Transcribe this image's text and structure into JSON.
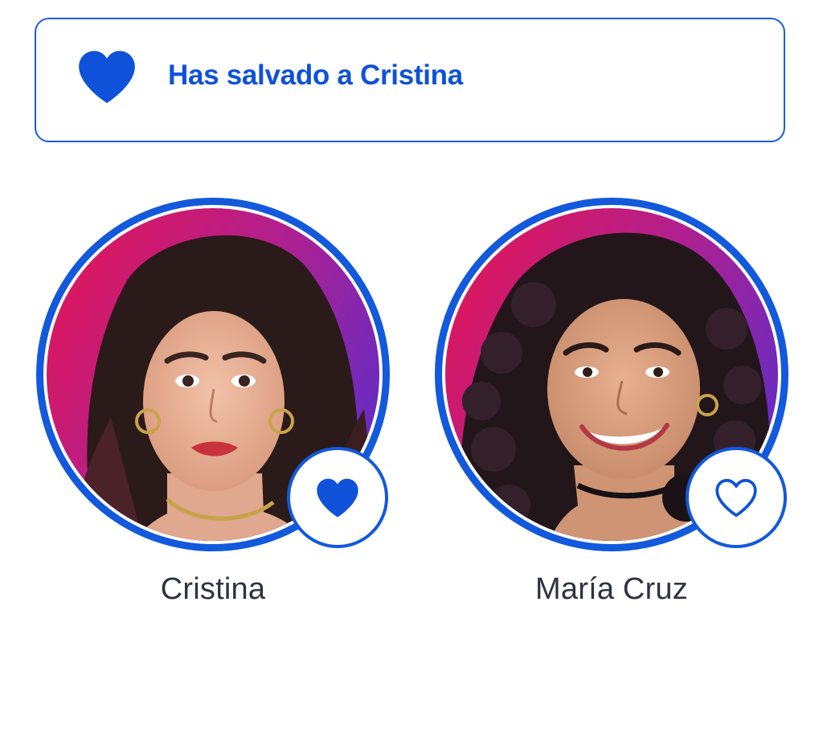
{
  "banner": {
    "icon": "heart-filled-icon",
    "text": "Has salvado a Cristina",
    "accent_color": "#0f52d9"
  },
  "contestants": [
    {
      "name": "Cristina",
      "vote_icon": "heart-filled-icon",
      "saved": true
    },
    {
      "name": "María Cruz",
      "vote_icon": "heart-outline-icon",
      "saved": false
    }
  ],
  "colors": {
    "ring": "#1259dc",
    "name_text": "#2d3342",
    "photo_bg_start": "#e8144f",
    "photo_bg_end": "#6a2bc0"
  }
}
